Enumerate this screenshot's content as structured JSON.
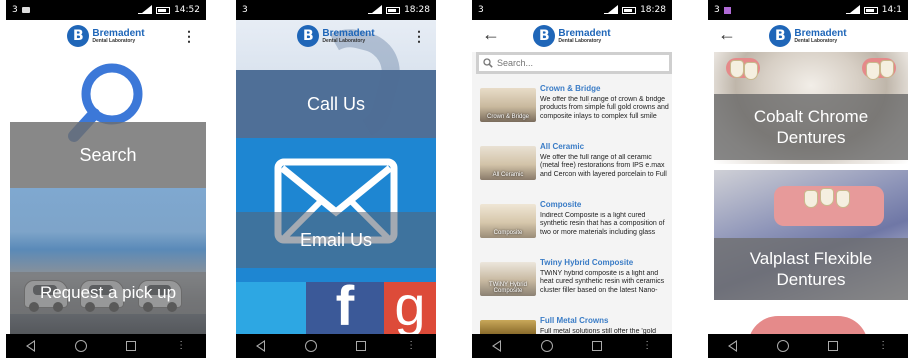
{
  "brand": {
    "initial": "B",
    "name": "Bremadent",
    "subtitle": "Dental Laboratory"
  },
  "screens": [
    {
      "status": {
        "left": "3",
        "time": "14:52"
      },
      "menu_icon": "more-vert-icon",
      "tiles": {
        "search": "Search",
        "pickup": "Request a pick up"
      }
    },
    {
      "status": {
        "left": "3",
        "time": "18:28"
      },
      "menu_icon": "more-vert-icon",
      "tiles": {
        "call": "Call Us",
        "email": "Email Us"
      },
      "social": {
        "facebook": "f",
        "google": "g"
      }
    },
    {
      "status": {
        "left": "3",
        "time": "18:28"
      },
      "search_placeholder": "Search...",
      "items": [
        {
          "title": "Crown & Bridge",
          "thumb": "Crown & Bridge",
          "desc": "We offer the full range of crown & bridge products from simple full gold crowns and composite inlays to complex full smile"
        },
        {
          "title": "All Ceramic",
          "thumb": "All Ceramic",
          "desc": "We offer the full range of all ceramic (metal free) restorations from IPS e.max and Cercon with layered porcelain to Full"
        },
        {
          "title": "Composite",
          "thumb": "Composite",
          "desc": "Indirect Composite is a light cured synthetic resin that has a composition of two or more materials including glass"
        },
        {
          "title": "Twiny Hybrid Composite",
          "thumb": "TWiNY Hybrid Composite",
          "desc": "TWiNY hybrid composite is a light and heat cured synthetic resin with ceramics cluster filler based on the latest Nano-"
        },
        {
          "title": "Full Metal Crowns",
          "thumb": "",
          "desc": "Full metal solutions still offer the 'gold"
        }
      ]
    },
    {
      "status": {
        "left": "3",
        "time": "14:1"
      },
      "tiles": {
        "cobalt_l1": "Cobalt Chrome",
        "cobalt_l2": "Dentures",
        "valplast_l1": "Valplast Flexible",
        "valplast_l2": "Dentures"
      }
    }
  ],
  "nav": {
    "more": "⋮"
  }
}
